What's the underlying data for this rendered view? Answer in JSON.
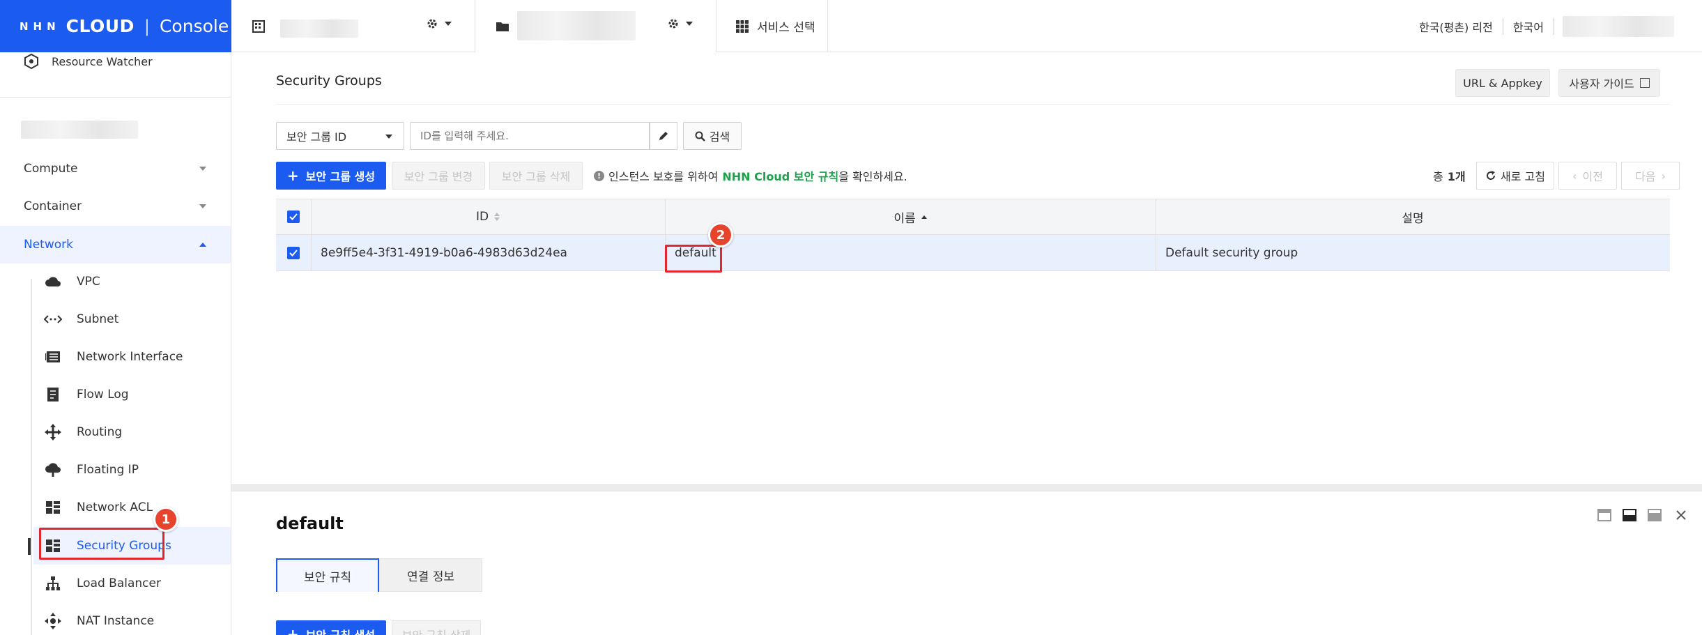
{
  "topbar": {
    "logo_nhn": "NHN",
    "logo_cloud": "CLOUD",
    "logo_sep": "|",
    "logo_console": "Console",
    "service_select": "서비스 선택",
    "region": "한국(평촌) 리전",
    "language": "한국어"
  },
  "sidebar": {
    "resource_watcher": "Resource Watcher",
    "categories": [
      {
        "label": "Compute"
      },
      {
        "label": "Container"
      },
      {
        "label": "Network"
      }
    ],
    "items": [
      {
        "label": "VPC",
        "icon": "cloud-icon"
      },
      {
        "label": "Subnet",
        "icon": "subnet-icon"
      },
      {
        "label": "Network Interface",
        "icon": "network-interface-icon"
      },
      {
        "label": "Flow Log",
        "icon": "flow-log-icon"
      },
      {
        "label": "Routing",
        "icon": "routing-icon"
      },
      {
        "label": "Floating IP",
        "icon": "floating-ip-icon"
      },
      {
        "label": "Network ACL",
        "icon": "network-acl-icon"
      },
      {
        "label": "Security Groups",
        "icon": "security-groups-icon"
      },
      {
        "label": "Load Balancer",
        "icon": "load-balancer-icon"
      },
      {
        "label": "NAT Instance",
        "icon": "nat-instance-icon"
      }
    ],
    "badge": "1"
  },
  "main": {
    "title": "Security Groups",
    "url_appkey": "URL & Appkey",
    "user_guide": "사용자 가이드",
    "filter_select": "보안 그룹 ID",
    "filter_placeholder": "ID를 입력해 주세요.",
    "search": "검색",
    "create_btn": "보안 그룹 생성",
    "modify_btn": "보안 그룹 변경",
    "delete_btn": "보안 그룹 삭제",
    "notice_pre": "인스턴스 보호를 위하여",
    "notice_link": "NHN Cloud 보안 규칙",
    "notice_post": "을 확인하세요.",
    "total_label": "총",
    "total_count": "1개",
    "refresh": "새로 고침",
    "prev": "이전",
    "next": "다음",
    "table": {
      "headers": {
        "id": "ID",
        "name": "이름",
        "desc": "설명"
      },
      "rows": [
        {
          "id": "8e9ff5e4-3f31-4919-b0a6-4983d63d24ea",
          "name": "default",
          "desc": "Default security group"
        }
      ]
    },
    "badge": "2"
  },
  "detail": {
    "title": "default",
    "tabs": [
      {
        "label": "보안 규칙"
      },
      {
        "label": "연결 정보"
      }
    ],
    "create_rule_btn": "보안 규칙 생성",
    "delete_rule_btn": "보안 규칙 삭제"
  },
  "colors": {
    "brand": "#1c5bf0",
    "highlight": "#e0262f",
    "link": "#1aa34a"
  }
}
